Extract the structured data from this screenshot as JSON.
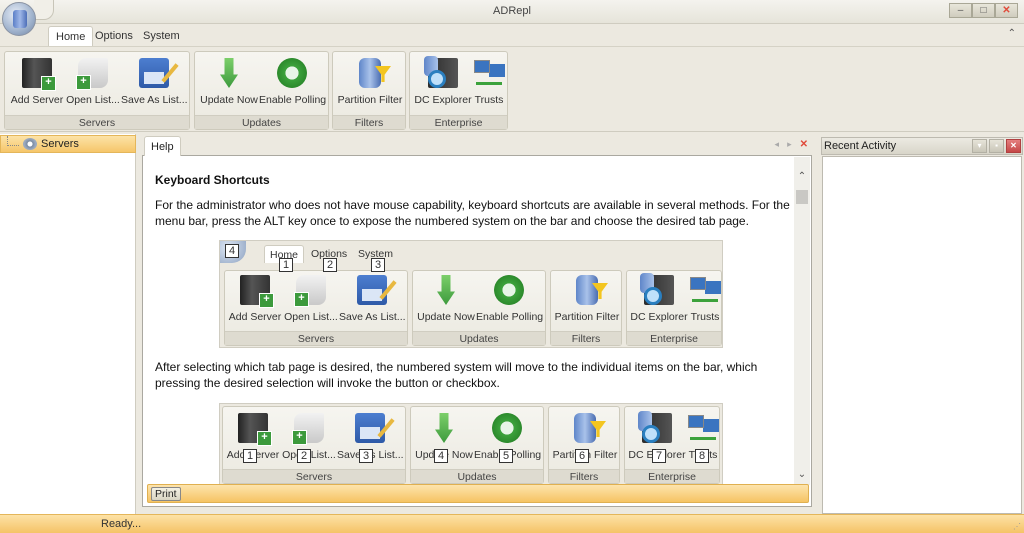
{
  "window": {
    "title": "ADRepl",
    "controls": {
      "minimize": "–",
      "maximize": "□",
      "close": "✕"
    }
  },
  "menu_tabs": [
    {
      "label": "Home",
      "active": true
    },
    {
      "label": "Options",
      "active": false
    },
    {
      "label": "System",
      "active": false
    }
  ],
  "ribbon_collapse_icon": "⌃",
  "ribbon": {
    "groups": [
      {
        "label": "Servers",
        "buttons": [
          {
            "label": "Add Server",
            "icon": "add-server-icon"
          },
          {
            "label": "Open List...",
            "icon": "open-list-icon"
          },
          {
            "label": "Save As List...",
            "icon": "save-list-icon"
          }
        ]
      },
      {
        "label": "Updates",
        "buttons": [
          {
            "label": "Update Now",
            "icon": "update-arrow-icon"
          },
          {
            "label": "Enable Polling",
            "icon": "refresh-icon"
          }
        ]
      },
      {
        "label": "Filters",
        "buttons": [
          {
            "label": "Partition Filter",
            "icon": "partition-filter-icon"
          }
        ]
      },
      {
        "label": "Enterprise",
        "buttons": [
          {
            "label": "DC Explorer",
            "icon": "dc-explorer-icon"
          },
          {
            "label": "Trusts",
            "icon": "trusts-icon"
          }
        ]
      }
    ]
  },
  "left_panel": {
    "tree_root": "Servers"
  },
  "help": {
    "tab_label": "Help",
    "nav": {
      "prev": "◂",
      "next": "▸",
      "close": "✕"
    },
    "heading": "Keyboard Shortcuts",
    "para1": "For the administrator who does not have mouse capability, keyboard shortcuts are available in several methods.  For the menu bar, press the ALT key once to expose the numbered system on the bar and choose the desired tab page.",
    "para2": "After selecting which tab page is desired, the numbered system will move to the individual items on the bar, which pressing the desired selection will invoke the button or checkbox.",
    "figure1_keys": {
      "orb": "4",
      "home": "1",
      "options": "2",
      "system": "3"
    },
    "figure2_keys": [
      "1",
      "2",
      "3",
      "4",
      "5",
      "6",
      "7",
      "8"
    ],
    "print_label": "Print",
    "scroll_up": "⌃",
    "scroll_down": "⌄"
  },
  "right_panel": {
    "title": "Recent Activity",
    "buttons": {
      "dropdown": "▾",
      "pin": "▪",
      "close": "✕"
    }
  },
  "status": {
    "text": "Ready...",
    "grip": "⋰"
  }
}
